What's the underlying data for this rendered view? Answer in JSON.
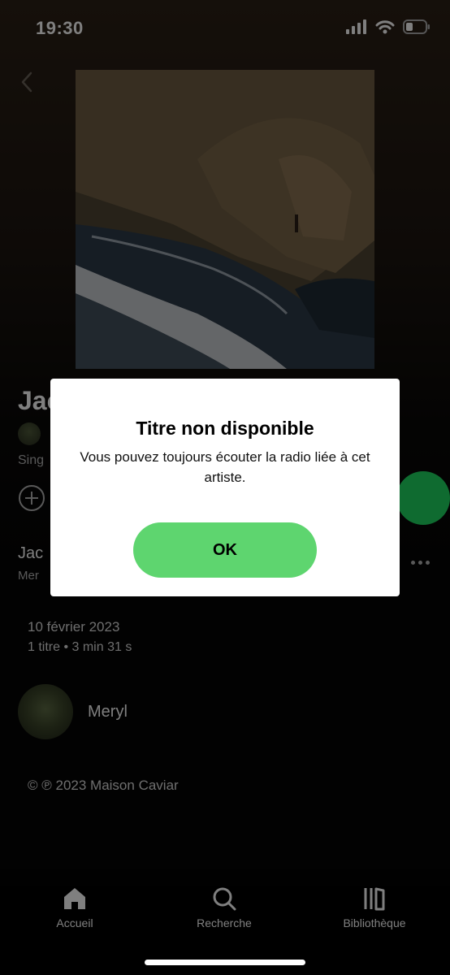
{
  "status_bar": {
    "time": "19:30"
  },
  "album": {
    "title_partial": "Jac",
    "type_partial": "Sing",
    "track_partial": "Jac",
    "track_artist_partial": "Mer",
    "release_date": "10 février 2023",
    "meta": "1 titre • 3 min 31 s",
    "artist_name": "Meryl",
    "copyright": "© ℗ 2023 Maison Caviar"
  },
  "modal": {
    "title": "Titre non disponible",
    "message": "Vous pouvez toujours écouter la radio liée à cet artiste.",
    "ok_label": "OK"
  },
  "bottom_nav": {
    "items": [
      {
        "label": "Accueil",
        "icon": "home-icon"
      },
      {
        "label": "Recherche",
        "icon": "search-icon"
      },
      {
        "label": "Bibliothèque",
        "icon": "library-icon"
      }
    ]
  },
  "colors": {
    "accent": "#1ed760",
    "ok_button": "#5ed56f"
  }
}
